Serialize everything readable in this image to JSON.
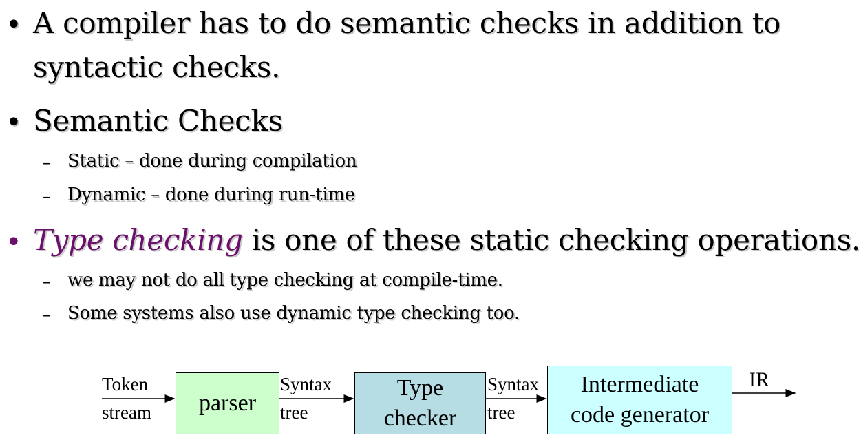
{
  "bullets": {
    "b1_line1": "A compiler has to do semantic checks in addition to",
    "b1_line2": "syntactic checks.",
    "b2": "Semantic Checks",
    "b2_sub1": "Static – done during compilation",
    "b2_sub2": "Dynamic – done during run-time",
    "b3_emph": "Type checking",
    "b3_rest": " is one of these static checking operations.",
    "b3_sub1": "we may not do all type checking at compile-time.",
    "b3_sub2": "Some systems also use dynamic type checking too.",
    "bullet_glyph": "•",
    "dash_glyph": "–"
  },
  "diagram": {
    "input_top": "Token",
    "input_bottom": "stream",
    "parser": "parser",
    "edge1_top": "Syntax",
    "edge1_bottom": "tree",
    "type_checker_line1": "Type",
    "type_checker_line2": "checker",
    "edge2_top": "Syntax",
    "edge2_bottom": "tree",
    "icg_line1": "Intermediate",
    "icg_line2": "code generator",
    "output": "IR",
    "colors": {
      "parser_fill": "#ccffcc",
      "type_checker_fill": "#b7dde4",
      "icg_fill": "#ccffff"
    }
  },
  "colors": {
    "emphasis": "#6b0f6b"
  }
}
